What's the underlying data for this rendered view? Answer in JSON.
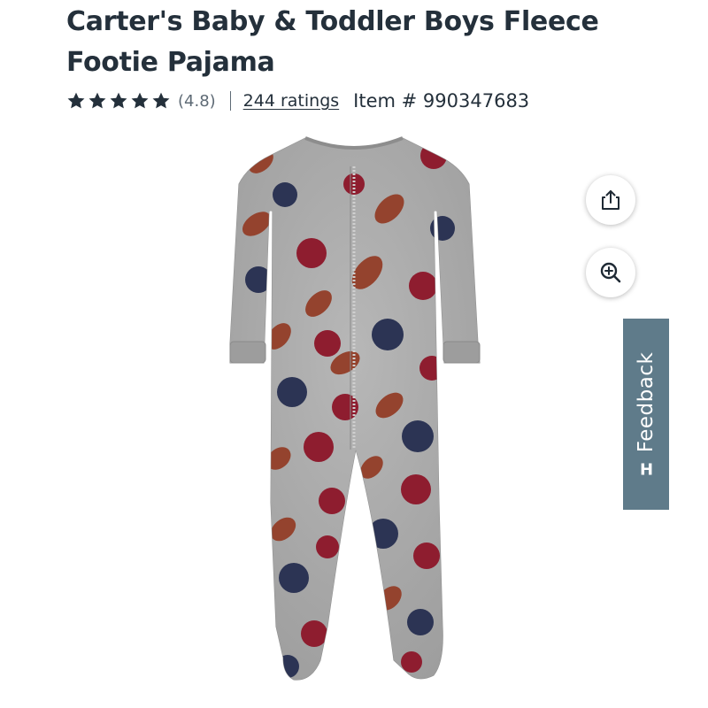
{
  "product": {
    "title": "Carter's Baby & Toddler Boys Fleece Footie Pajama",
    "rating_value": 4.8,
    "rating_text": "(4.8)",
    "stars_filled": 5,
    "ratings_link": "244 ratings",
    "item_number": "Item # 990347683"
  },
  "image": {
    "alt": "Carter's Baby & Toddler Boys Fleece Footie Pajama"
  },
  "actions": {
    "share_icon": "share-icon",
    "zoom_icon": "zoom-in-icon"
  },
  "feedback": {
    "label": "Feedback",
    "icon": "H"
  },
  "colors": {
    "text": "#24303b",
    "muted": "#5e6a75",
    "feedback_bg": "#5f7b8a",
    "fabric": "#a9a9a9",
    "helmet_red": "#8e1d2f",
    "helmet_navy": "#2c3454",
    "football_brown": "#94432e"
  }
}
